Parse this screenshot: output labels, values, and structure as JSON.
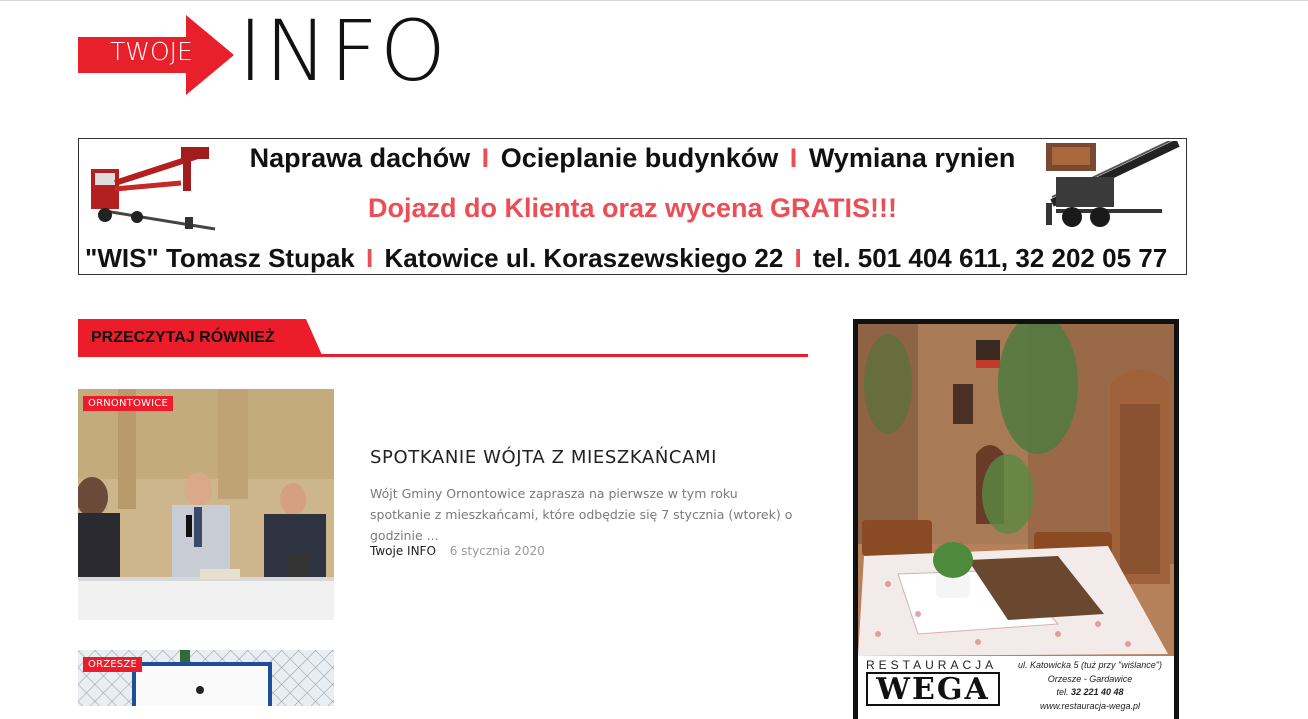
{
  "logo": {
    "small": "TWOJE",
    "big": "INFO"
  },
  "banner": {
    "line1": [
      "Naprawa dachów",
      "Ocieplanie budynków",
      "Wymiana rynien"
    ],
    "separator": "I",
    "line2": "Dojazd do Klienta oraz wycena GRATIS!!!",
    "line3": [
      "\"WIS\" Tomasz Stupak",
      "Katowice ul. Koraszewskiego 22",
      "tel. 501 404 611, 32 202 05 77"
    ]
  },
  "section": {
    "title": "PRZECZYTAJ RÓWNIEŻ"
  },
  "articles": [
    {
      "category": "ORNONTOWICE",
      "title": "SPOTKANIE WÓJTA Z MIESZKAŃCAMI",
      "excerpt": "Wójt Gminy Ornontowice zaprasza na pierwsze w tym roku spotkanie z mieszkańcami, które odbędzie się 7 stycznia (wtorek) o godzinie ...",
      "author": "Twoje INFO",
      "date": "6 stycznia 2020"
    },
    {
      "category": "ORZESZE"
    }
  ],
  "side_ad": {
    "label": "RESTAURACJA",
    "name": "WEGA",
    "address": "ul. Katowicka 5 (tuż przy \"wiślance\")",
    "town": "Orzesze - Gardawice",
    "tel_prefix": "tel.",
    "tel": "32 221 40 48",
    "www": "www.restauracja-wega.pl"
  },
  "colors": {
    "accent": "#ec1c2a",
    "banner_red": "#ec4e55"
  }
}
